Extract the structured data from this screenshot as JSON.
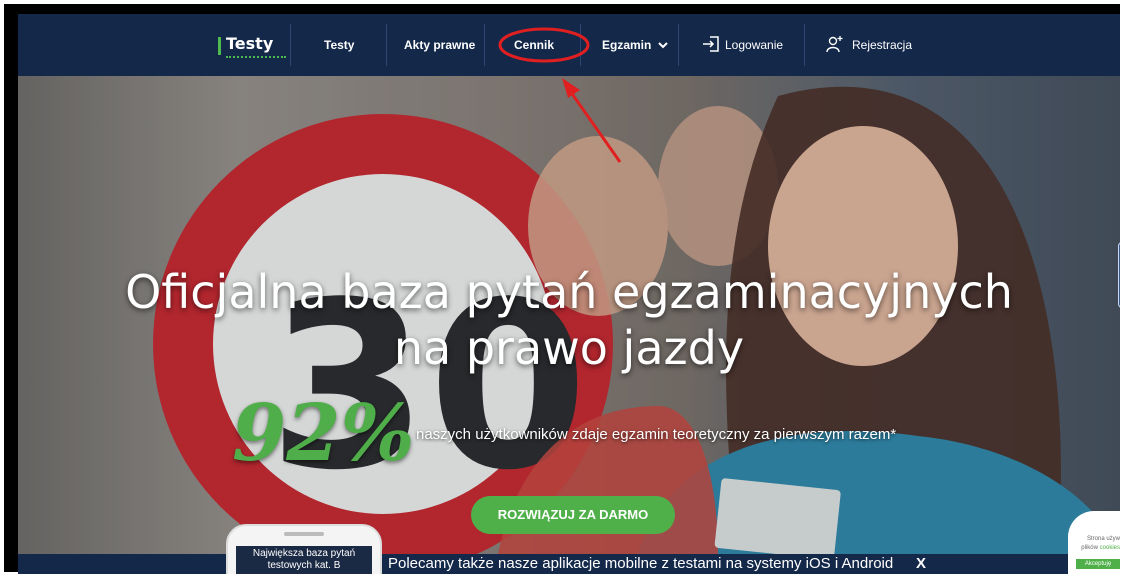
{
  "nav": {
    "logo": "Testy",
    "items": [
      {
        "label": "Testy"
      },
      {
        "label": "Akty prawne"
      },
      {
        "label": "Cennik"
      },
      {
        "label": "Egzamin"
      },
      {
        "label": "Logowanie"
      },
      {
        "label": "Rejestracja"
      }
    ]
  },
  "hero": {
    "headline_line1": "Oficjalna baza pytań egzaminacyjnych",
    "headline_line2": "na prawo jazdy",
    "percent": "92%",
    "percent_text": "naszych użytkowników zdaje egzamin teoretyczny za pierwszym razem*",
    "cta": "ROZWIĄZUJ ZA DARMO"
  },
  "bottom_bar": {
    "text": "Polecamy także nasze aplikacje mobilne z testami na systemy iOS i Android",
    "close": "X",
    "phone_line1": "Największa baza pytań",
    "phone_line2": "testowych kat. B"
  },
  "cookie": {
    "text1": "Strona używ",
    "text2": "plików",
    "link": "cookies",
    "button": "Akceptuję"
  },
  "colors": {
    "nav_bg": "#14284a",
    "accent_green": "#4fb04a",
    "highlight_red": "#e02020"
  }
}
